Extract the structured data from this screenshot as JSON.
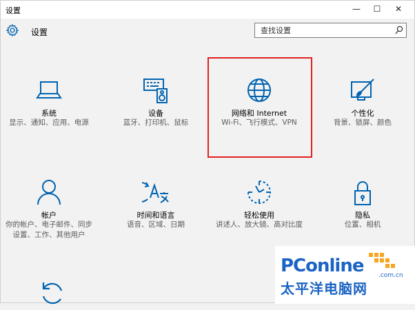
{
  "window": {
    "title": "设置",
    "minimize_glyph": "—",
    "maximize_glyph": "☐",
    "close_glyph": "✕"
  },
  "header": {
    "title": "设置",
    "search_placeholder": "查找设置"
  },
  "tiles": [
    {
      "name": "系统",
      "desc": "显示、通知、应用、电源",
      "icon": "laptop-icon"
    },
    {
      "name": "设备",
      "desc": "蓝牙、打印机、鼠标",
      "icon": "devices-icon"
    },
    {
      "name": "网络和 Internet",
      "desc": "Wi-Fi、飞行模式、VPN",
      "icon": "globe-icon"
    },
    {
      "name": "个性化",
      "desc": "背景、锁屏、颜色",
      "icon": "personalization-icon"
    },
    {
      "name": "帐户",
      "desc": "你的帐户、电子邮件、同步设置、工作、其他用户",
      "icon": "person-icon"
    },
    {
      "name": "时间和语言",
      "desc": "语音、区域、日期",
      "icon": "time-language-icon"
    },
    {
      "name": "轻松使用",
      "desc": "讲述人、放大镜、高对比度",
      "icon": "ease-of-access-icon"
    },
    {
      "name": "隐私",
      "desc": "位置、相机",
      "icon": "lock-icon"
    },
    {
      "name": "",
      "desc": "",
      "icon": "update-icon"
    }
  ],
  "watermark": {
    "brand": "PConline",
    "domain": ".com.cn",
    "cn_name": "太平洋电脑网"
  },
  "colors": {
    "accent": "#0063b1",
    "highlight": "#e02020",
    "watermark": "#1b63c4"
  }
}
